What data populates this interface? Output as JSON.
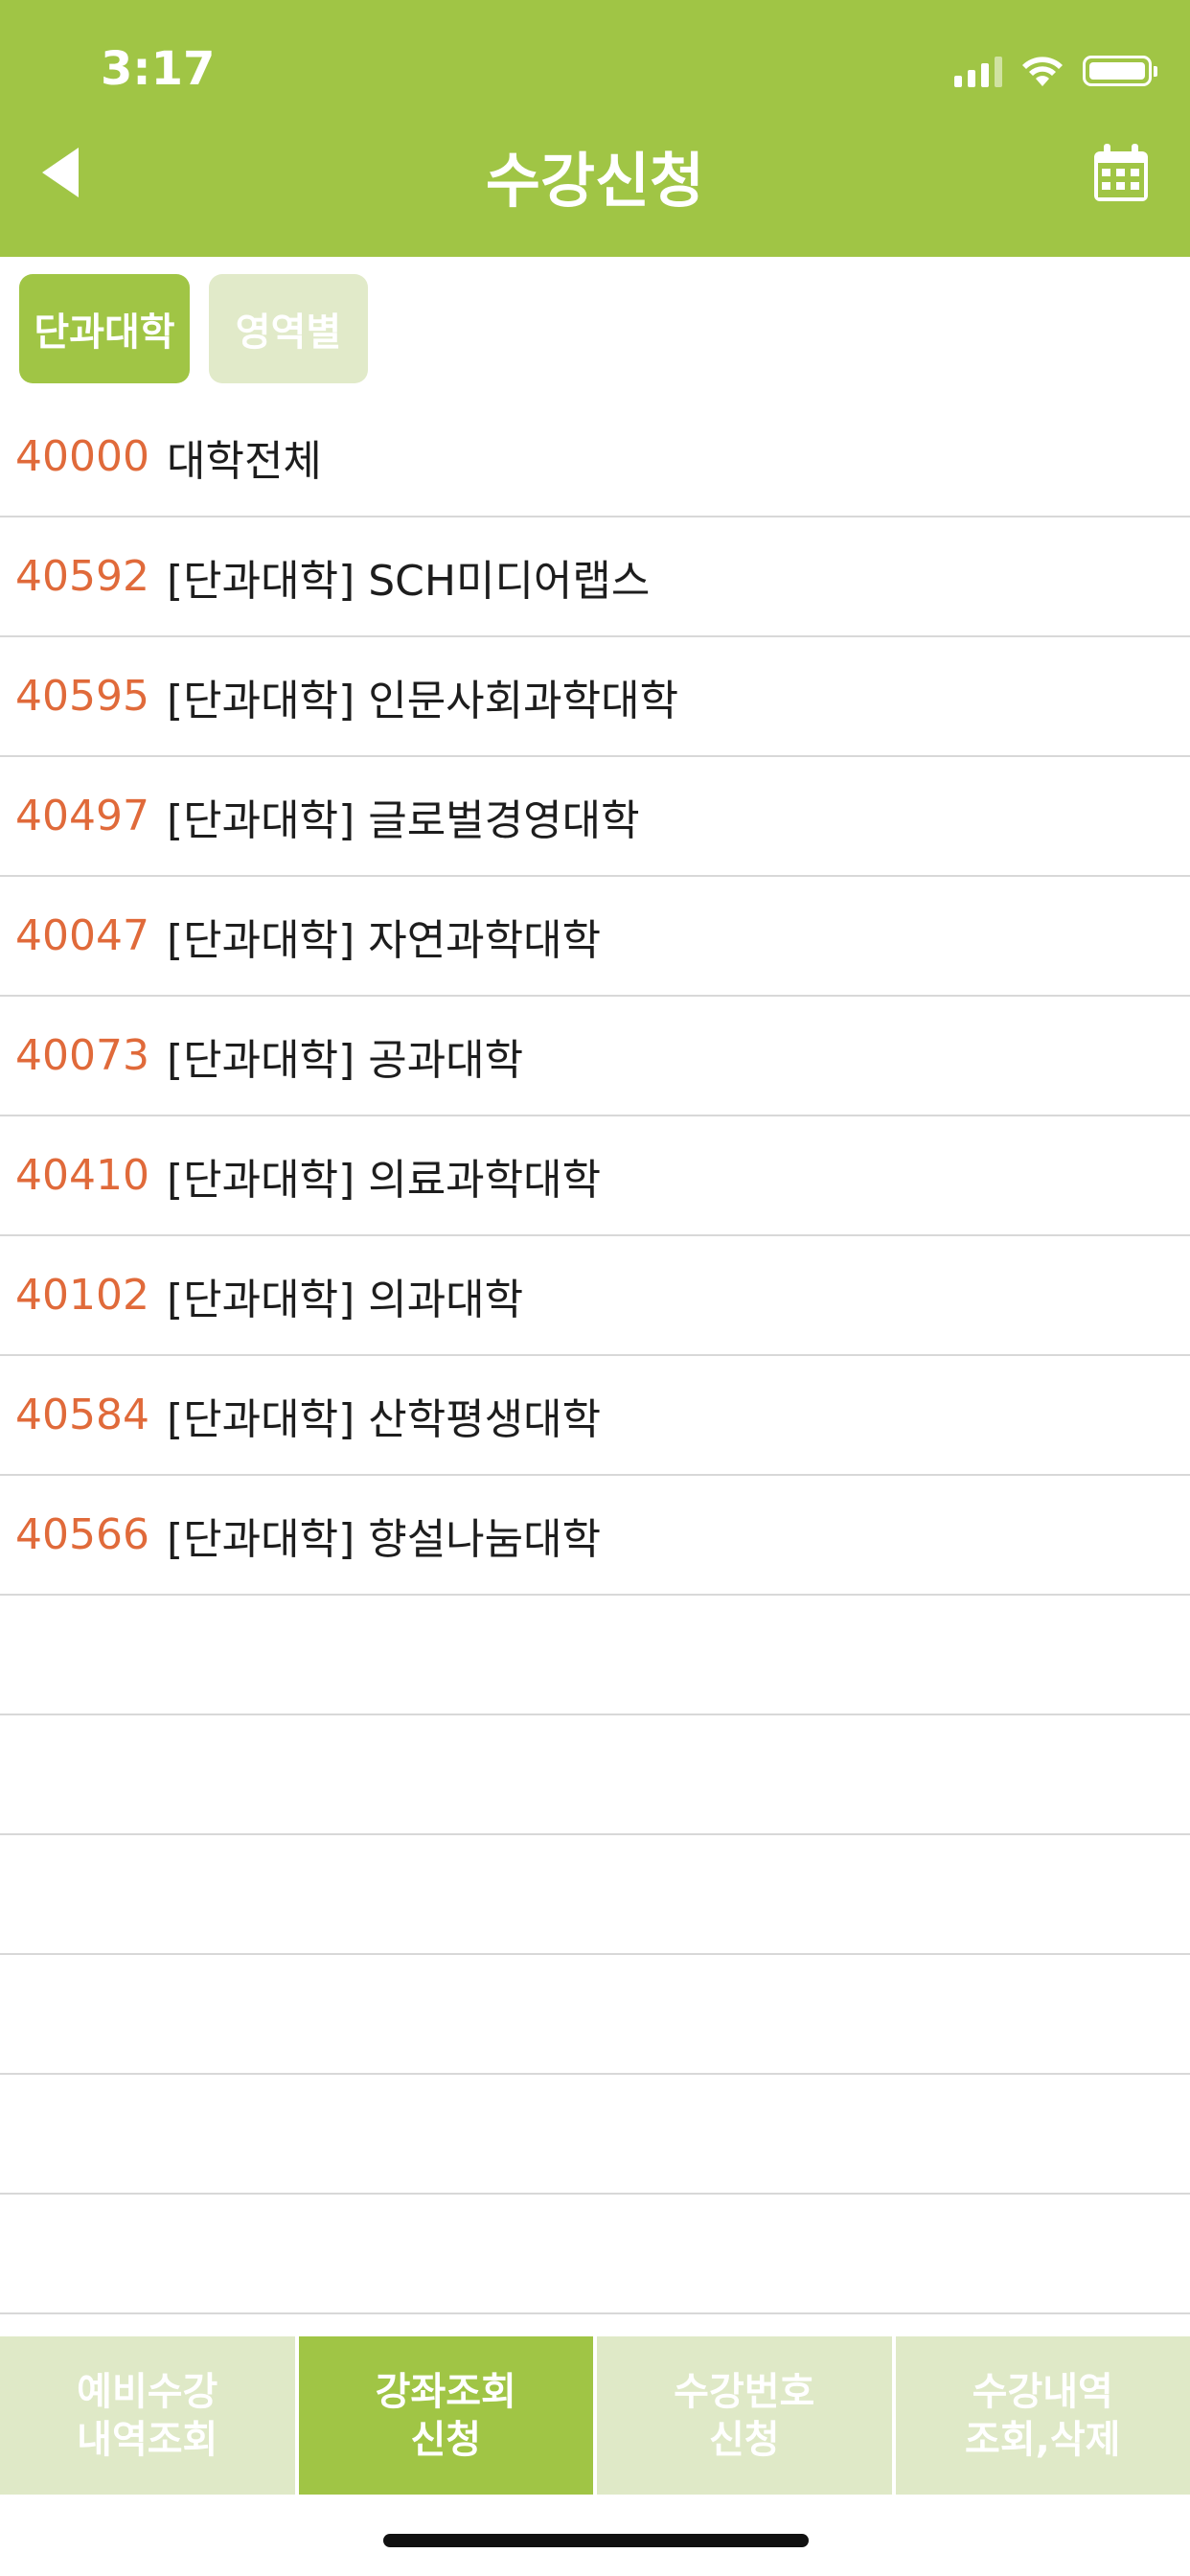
{
  "status_bar": {
    "time": "3:17"
  },
  "header": {
    "title": "수강신청",
    "back_icon": "back-arrow-icon",
    "calendar_icon": "calendar-icon"
  },
  "filters": {
    "active": "단과대학",
    "inactive": "영역별"
  },
  "colors": {
    "accent": "#a0c545",
    "code_color": "#e06a3a",
    "inactive_tab": "#e1eac9"
  },
  "list": [
    {
      "code": "40000",
      "name": "대학전체"
    },
    {
      "code": "40592",
      "name": "[단과대학] SCH미디어랩스"
    },
    {
      "code": "40595",
      "name": "[단과대학] 인문사회과학대학"
    },
    {
      "code": "40497",
      "name": "[단과대학] 글로벌경영대학"
    },
    {
      "code": "40047",
      "name": "[단과대학] 자연과학대학"
    },
    {
      "code": "40073",
      "name": "[단과대학] 공과대학"
    },
    {
      "code": "40410",
      "name": "[단과대학] 의료과학대학"
    },
    {
      "code": "40102",
      "name": "[단과대학] 의과대학"
    },
    {
      "code": "40584",
      "name": "[단과대학] 산학평생대학"
    },
    {
      "code": "40566",
      "name": "[단과대학] 향설나눔대학"
    }
  ],
  "bottom_tabs": [
    {
      "label": "예비수강\n내역조회"
    },
    {
      "label": "강좌조회\n신청"
    },
    {
      "label": "수강번호\n신청"
    },
    {
      "label": "수강내역\n조회,삭제"
    }
  ]
}
